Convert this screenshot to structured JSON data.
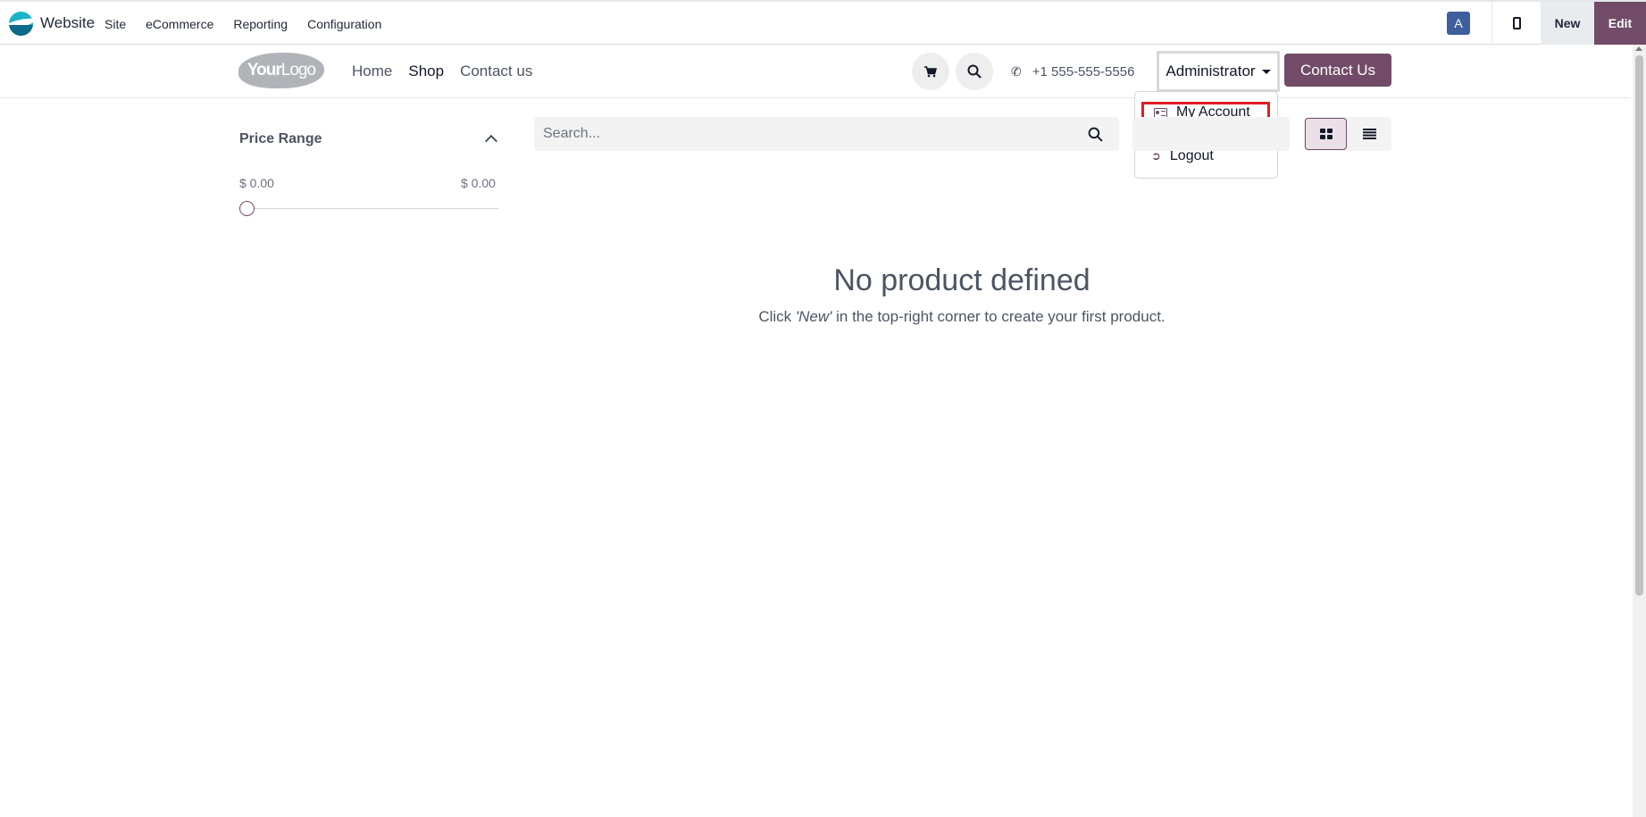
{
  "admin_bar": {
    "brand": "Website",
    "menu": [
      "Site",
      "eCommerce",
      "Reporting",
      "Configuration"
    ],
    "avatar_letter": "A",
    "new_label": "New",
    "edit_label": "Edit"
  },
  "site_header": {
    "logo_text_bold": "Your",
    "logo_text": "Logo",
    "nav": [
      "Home",
      "Shop",
      "Contact us"
    ],
    "active_nav": "Shop",
    "phone": "+1 555-555-5556",
    "user_menu": "Administrator",
    "contact_button": "Contact Us"
  },
  "user_dropdown": {
    "items": [
      {
        "label": "My Account",
        "icon": "id-card-icon",
        "highlighted": true
      },
      {
        "label": "Logout",
        "icon": "sign-out-icon",
        "highlighted": false
      }
    ]
  },
  "sidebar": {
    "price_range_title": "Price Range",
    "price_min": "$ 0.00",
    "price_max": "$ 0.00"
  },
  "search": {
    "placeholder": "Search..."
  },
  "empty_state": {
    "title": "No product defined",
    "text_before": "Click ",
    "text_emph": "'New'",
    "text_after": " in the top-right corner to create your first product."
  },
  "colors": {
    "brand_purple": "#714b67",
    "highlight_red": "#e11d25",
    "avatar_blue": "#3f5f9c"
  }
}
